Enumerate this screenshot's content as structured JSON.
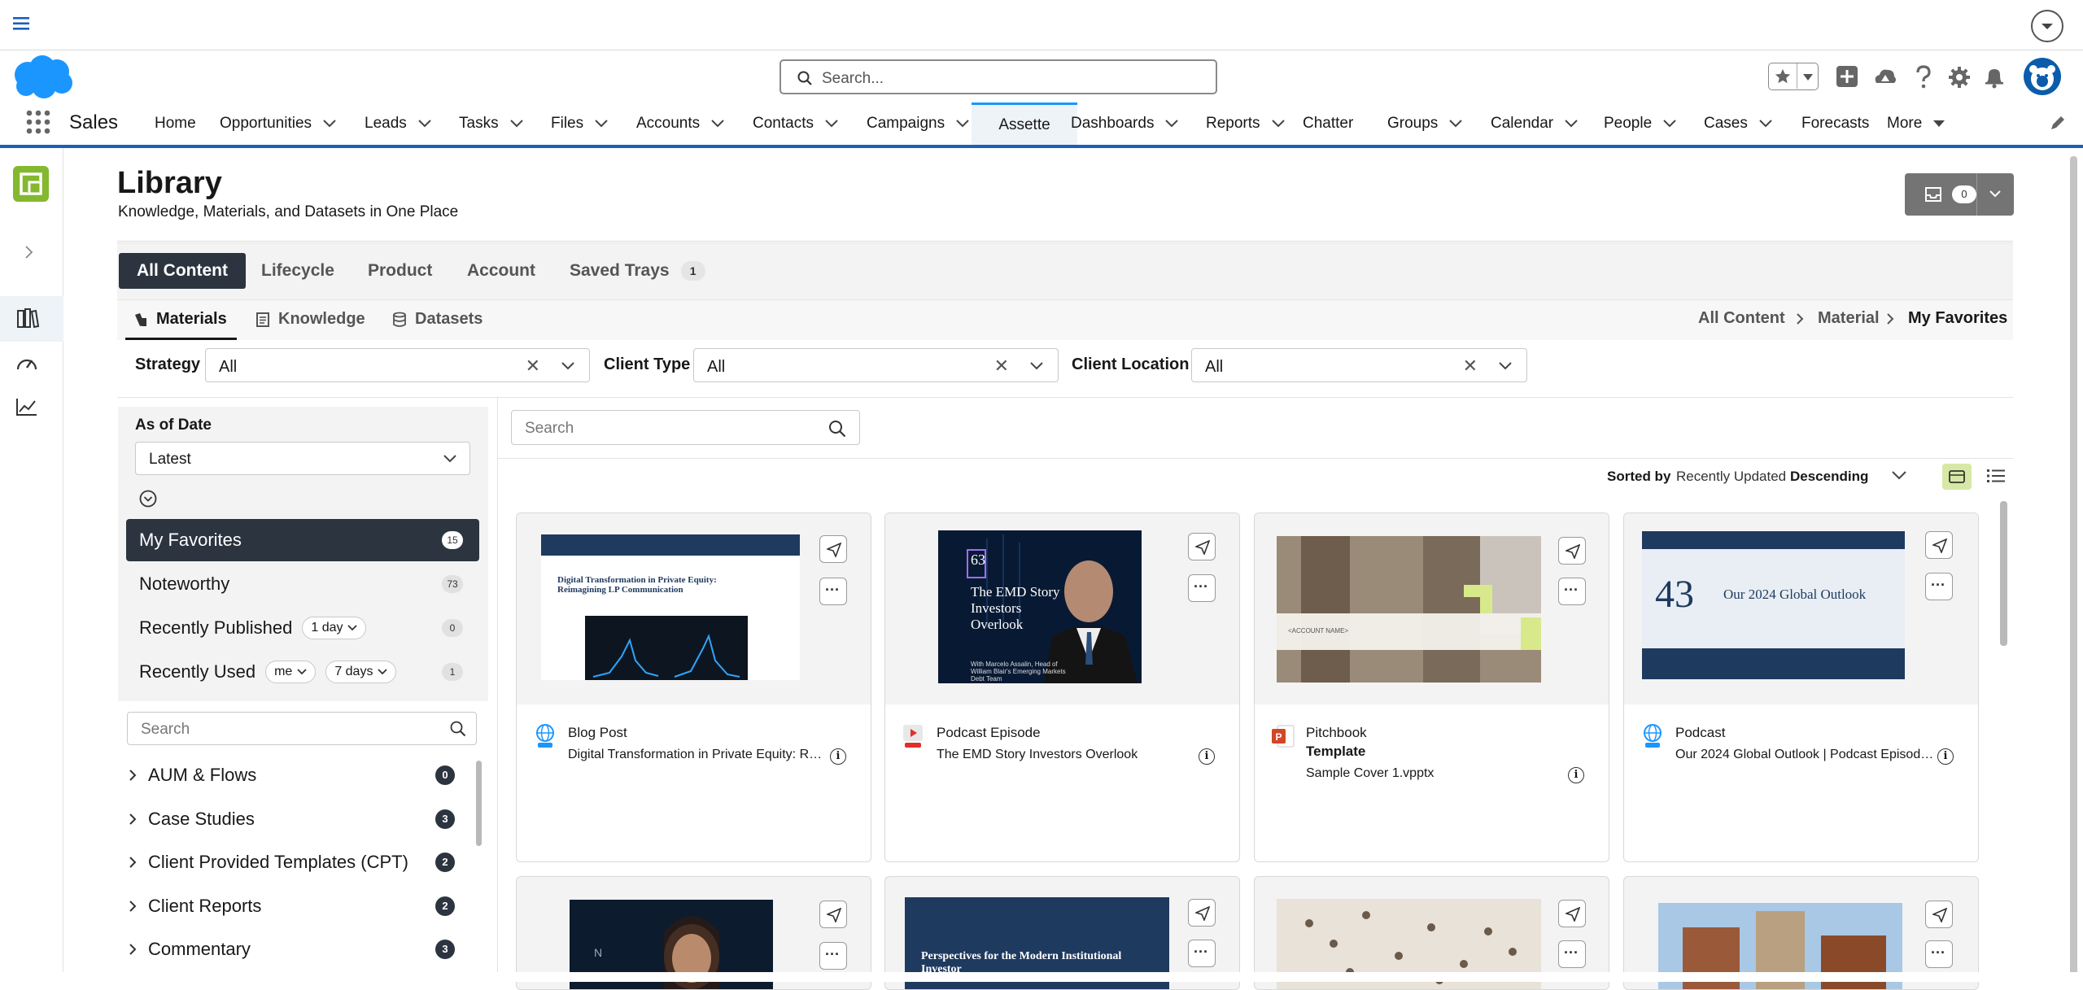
{
  "header": {
    "app_name": "Sales",
    "search_placeholder": "Search...",
    "nav_items": [
      {
        "label": "Home",
        "chevron": false
      },
      {
        "label": "Opportunities",
        "chevron": true
      },
      {
        "label": "Leads",
        "chevron": true
      },
      {
        "label": "Tasks",
        "chevron": true
      },
      {
        "label": "Files",
        "chevron": true
      },
      {
        "label": "Accounts",
        "chevron": true
      },
      {
        "label": "Contacts",
        "chevron": true
      },
      {
        "label": "Campaigns",
        "chevron": true
      },
      {
        "label": "Assette",
        "chevron": false,
        "active": true
      },
      {
        "label": "Dashboards",
        "chevron": true
      },
      {
        "label": "Reports",
        "chevron": true
      },
      {
        "label": "Chatter",
        "chevron": false
      },
      {
        "label": "Groups",
        "chevron": true
      },
      {
        "label": "Calendar",
        "chevron": true
      },
      {
        "label": "People",
        "chevron": true
      },
      {
        "label": "Cases",
        "chevron": true
      },
      {
        "label": "Forecasts",
        "chevron": false
      },
      {
        "label": "More",
        "chevron": true
      }
    ]
  },
  "page": {
    "title": "Library",
    "subtitle": "Knowledge, Materials, and Datasets in One Place",
    "tray_count": "0"
  },
  "tabs": [
    {
      "label": "All Content",
      "active": true
    },
    {
      "label": "Lifecycle"
    },
    {
      "label": "Product"
    },
    {
      "label": "Account"
    },
    {
      "label": "Saved Trays",
      "badge": "1"
    }
  ],
  "subtabs": [
    {
      "label": "Materials",
      "active": true
    },
    {
      "label": "Knowledge"
    },
    {
      "label": "Datasets"
    }
  ],
  "breadcrumb": [
    "All Content",
    "Material",
    "My Favorites"
  ],
  "filters": [
    {
      "label": "Strategy",
      "value": "All"
    },
    {
      "label": "Client Type",
      "value": "All"
    },
    {
      "label": "Client Location",
      "value": "All"
    }
  ],
  "left_panel": {
    "as_of_label": "As of Date",
    "as_of_value": "Latest",
    "lists": [
      {
        "label": "My Favorites",
        "count": "15",
        "active": true
      },
      {
        "label": "Noteworthy",
        "count": "73"
      },
      {
        "label": "Recently Published",
        "count": "0",
        "pill1": "1 day"
      },
      {
        "label": "Recently Used",
        "count": "1",
        "pill1": "me",
        "pill2": "7 days"
      }
    ],
    "search_placeholder": "Search",
    "categories": [
      {
        "label": "AUM & Flows",
        "count": "0"
      },
      {
        "label": "Case Studies",
        "count": "3"
      },
      {
        "label": "Client Provided Templates (CPT)",
        "count": "2"
      },
      {
        "label": "Client Reports",
        "count": "2"
      },
      {
        "label": "Commentary",
        "count": "3"
      }
    ]
  },
  "content": {
    "search_placeholder": "Search",
    "sorted_by_label": "Sorted by",
    "sort_field": "Recently Updated",
    "sort_dir": "Descending",
    "cards": [
      {
        "type": "Blog Post",
        "title": "Digital Transformation in Private Equity: Reim...",
        "thumb_heading": "Digital Transformation in Private Equity: Reimagining LP Communication"
      },
      {
        "type": "Podcast Episode",
        "title": "The EMD Story Investors Overlook",
        "thumb_number": "63",
        "thumb_heading": "The EMD Story Investors Overlook",
        "thumb_caption": "With Marcelo Assalin, Head of William Blair's Emerging Markets Debt Team"
      },
      {
        "type": "Pitchbook",
        "template_label": "Template",
        "title": "Sample Cover 1.vpptx",
        "thumb_text": "<ACCOUNT NAME>"
      },
      {
        "type": "Podcast",
        "title": "Our 2024 Global Outlook | Podcast Episode 4...",
        "thumb_number": "43",
        "thumb_heading": "Our 2024 Global Outlook"
      }
    ],
    "row2_thumb_text": "Perspectives for the Modern Institutional Investor"
  }
}
